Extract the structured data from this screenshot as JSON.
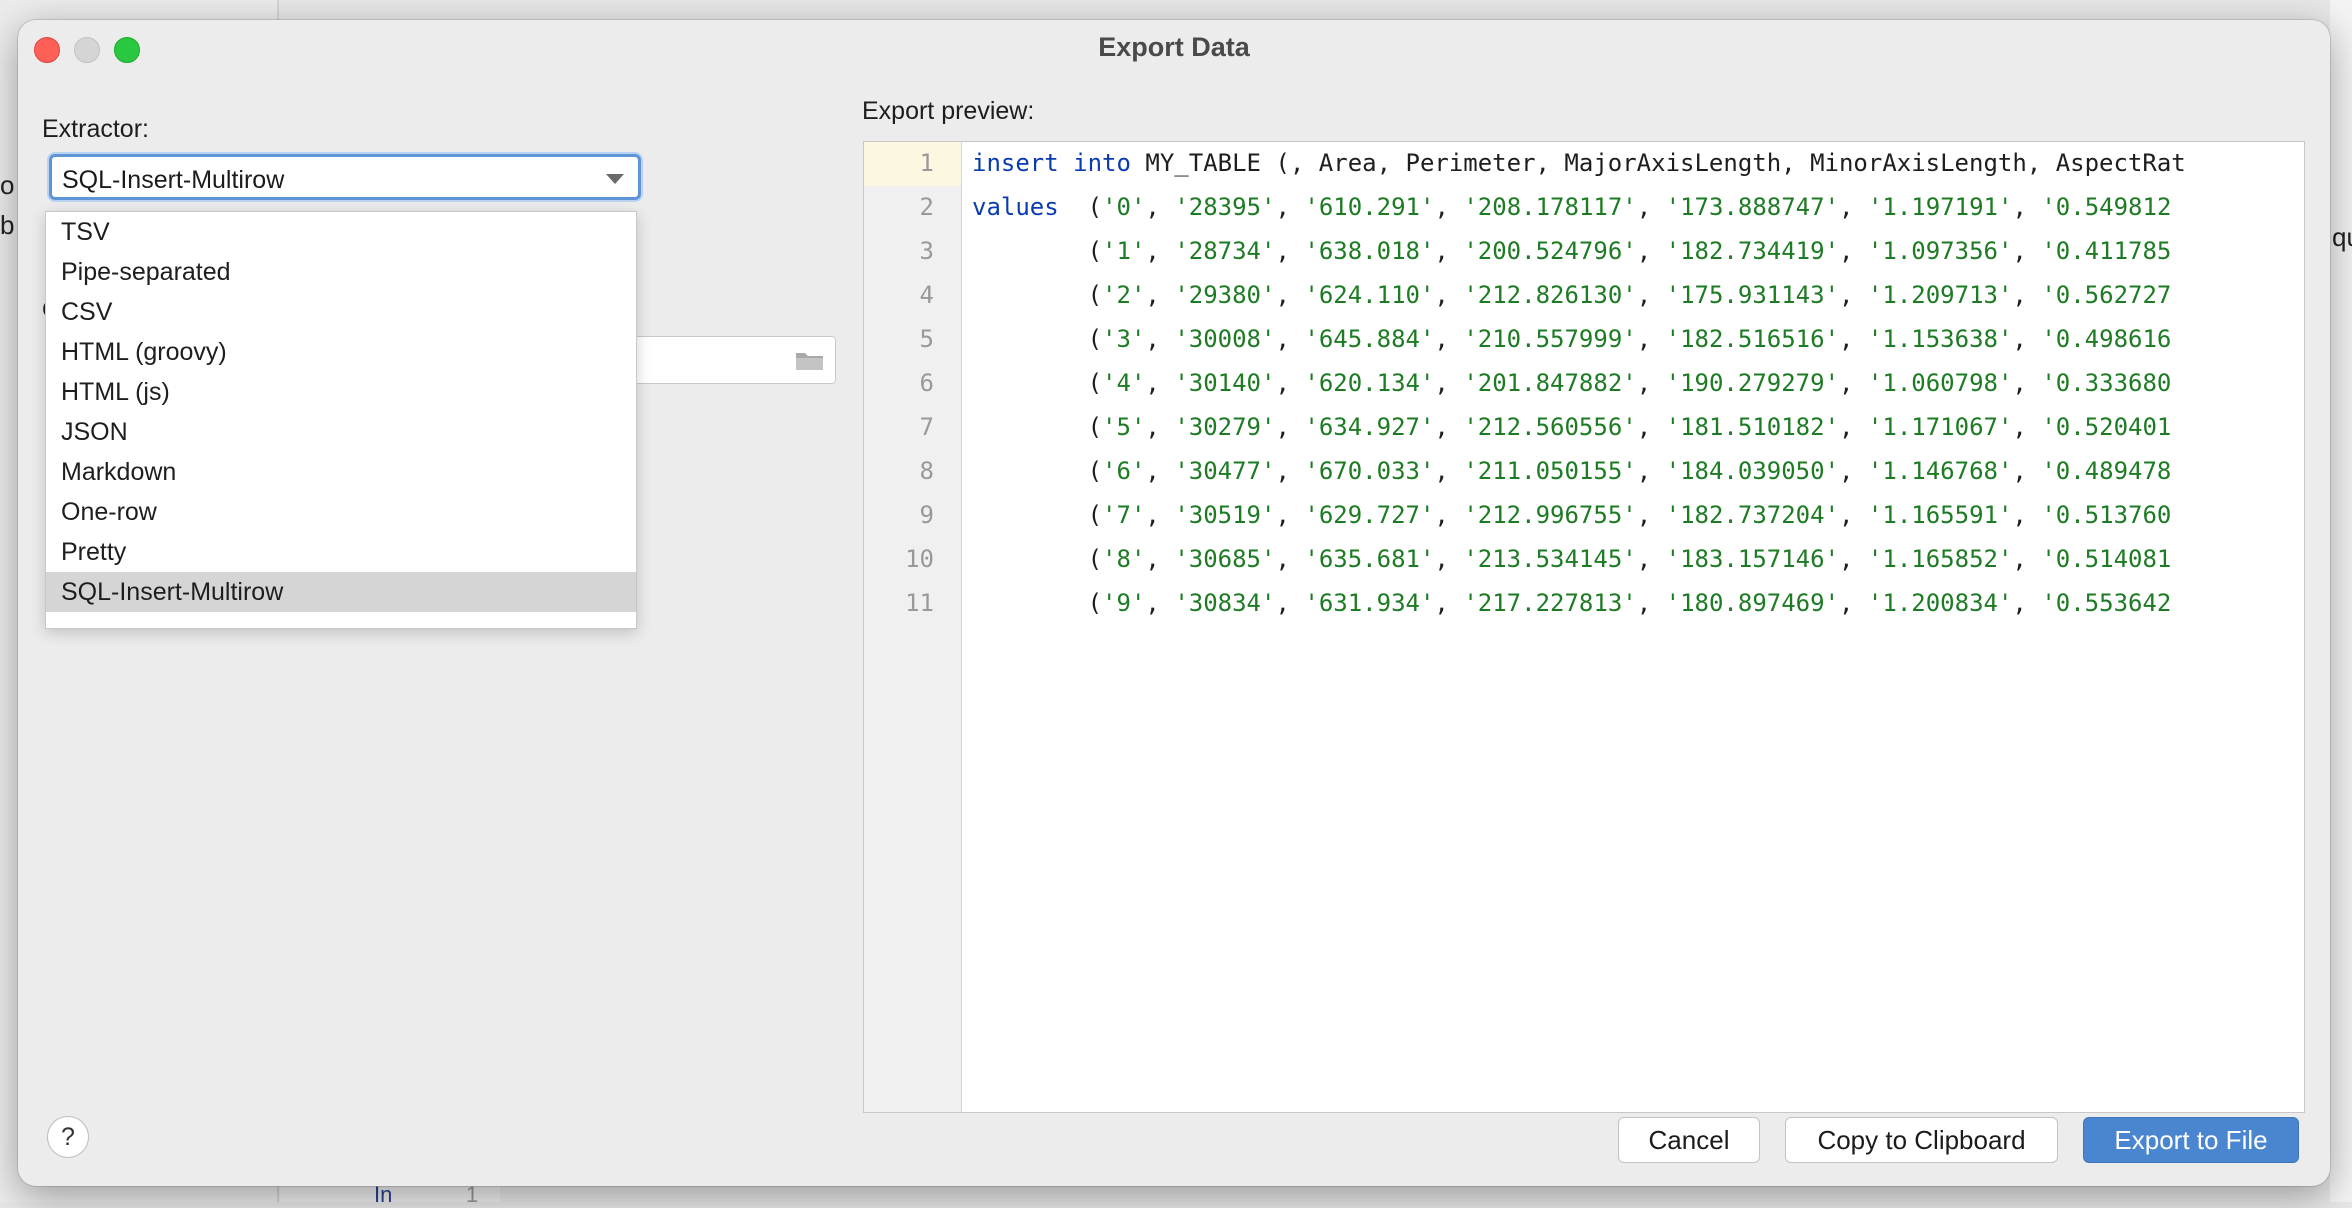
{
  "background": {
    "left_fragments": [
      "o",
      "b"
    ],
    "right_fragment": "qu",
    "bottom_gutter": "In",
    "bottom_number": "1"
  },
  "dialog": {
    "title": "Export Data",
    "extractor_label": "Extractor:",
    "extractor_selected": "SQL-Insert-Multirow",
    "extractor_options": [
      "TSV",
      "Pipe-separated",
      "CSV",
      "HTML (groovy)",
      "HTML (js)",
      "JSON",
      "Markdown",
      "One-row",
      "Pretty",
      "SQL-Insert-Multirow"
    ],
    "obscured_letter": "O",
    "preview_label": "Export preview:",
    "preview": {
      "header": {
        "line": "1",
        "kw1": "insert",
        "kw2": "into",
        "rest": " MY_TABLE (, Area, Perimeter, MajorAxisLength, MinorAxisLength, AspectRat"
      },
      "values_keyword": "values",
      "rows": [
        {
          "line": "2",
          "vals": [
            "'0'",
            "'28395'",
            "'610.291'",
            "'208.178117'",
            "'173.888747'",
            "'1.197191'",
            "'0.549812"
          ]
        },
        {
          "line": "3",
          "vals": [
            "'1'",
            "'28734'",
            "'638.018'",
            "'200.524796'",
            "'182.734419'",
            "'1.097356'",
            "'0.411785"
          ]
        },
        {
          "line": "4",
          "vals": [
            "'2'",
            "'29380'",
            "'624.110'",
            "'212.826130'",
            "'175.931143'",
            "'1.209713'",
            "'0.562727"
          ]
        },
        {
          "line": "5",
          "vals": [
            "'3'",
            "'30008'",
            "'645.884'",
            "'210.557999'",
            "'182.516516'",
            "'1.153638'",
            "'0.498616"
          ]
        },
        {
          "line": "6",
          "vals": [
            "'4'",
            "'30140'",
            "'620.134'",
            "'201.847882'",
            "'190.279279'",
            "'1.060798'",
            "'0.333680"
          ]
        },
        {
          "line": "7",
          "vals": [
            "'5'",
            "'30279'",
            "'634.927'",
            "'212.560556'",
            "'181.510182'",
            "'1.171067'",
            "'0.520401"
          ]
        },
        {
          "line": "8",
          "vals": [
            "'6'",
            "'30477'",
            "'670.033'",
            "'211.050155'",
            "'184.039050'",
            "'1.146768'",
            "'0.489478"
          ]
        },
        {
          "line": "9",
          "vals": [
            "'7'",
            "'30519'",
            "'629.727'",
            "'212.996755'",
            "'182.737204'",
            "'1.165591'",
            "'0.513760"
          ]
        },
        {
          "line": "10",
          "vals": [
            "'8'",
            "'30685'",
            "'635.681'",
            "'213.534145'",
            "'183.157146'",
            "'1.165852'",
            "'0.514081"
          ]
        },
        {
          "line": "11",
          "vals": [
            "'9'",
            "'30834'",
            "'631.934'",
            "'217.227813'",
            "'180.897469'",
            "'1.200834'",
            "'0.553642"
          ]
        }
      ]
    },
    "help_label": "?",
    "buttons": {
      "cancel": "Cancel",
      "copy": "Copy to Clipboard",
      "export": "Export to File"
    }
  }
}
